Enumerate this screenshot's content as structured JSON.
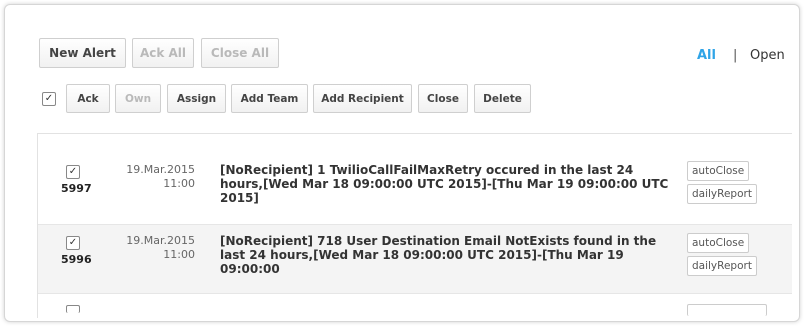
{
  "toolbar_top": {
    "new_alert": "New Alert",
    "ack_all": "Ack All",
    "close_all": "Close All"
  },
  "filters": {
    "all": "All",
    "separator": "|",
    "open": "Open"
  },
  "toolbar_actions": {
    "select_all_checked": true,
    "ack": "Ack",
    "own": "Own",
    "assign": "Assign",
    "add_team": "Add Team",
    "add_recipient": "Add Recipient",
    "close": "Close",
    "delete": "Delete"
  },
  "alerts": [
    {
      "id": "5997",
      "date": "19.Mar.2015",
      "time": "11:00",
      "checked": true,
      "message_lines": [
        "[NoRecipient] 1 TwilioCallFailMaxRetry occured in the last 24",
        "hours,[Wed Mar 18 09:00:00 UTC 2015]-[Thu Mar 19 09:00:00 UTC",
        "2015]"
      ],
      "tags": [
        "autoClose",
        "dailyReport"
      ]
    },
    {
      "id": "5996",
      "date": "19.Mar.2015",
      "time": "11:00",
      "checked": true,
      "message_lines": [
        "[NoRecipient] 718 User Destination Email NotExists found in the",
        "last 24 hours,[Wed Mar 18 09:00:00 UTC 2015]-[Thu Mar 19 09:00:00"
      ],
      "tags": [
        "autoClose",
        "dailyReport"
      ]
    }
  ],
  "colors": {
    "accent": "#2fa4e7",
    "disabled_text": "#b9b9b9",
    "selected_row_bg": "#f4f4f4"
  }
}
